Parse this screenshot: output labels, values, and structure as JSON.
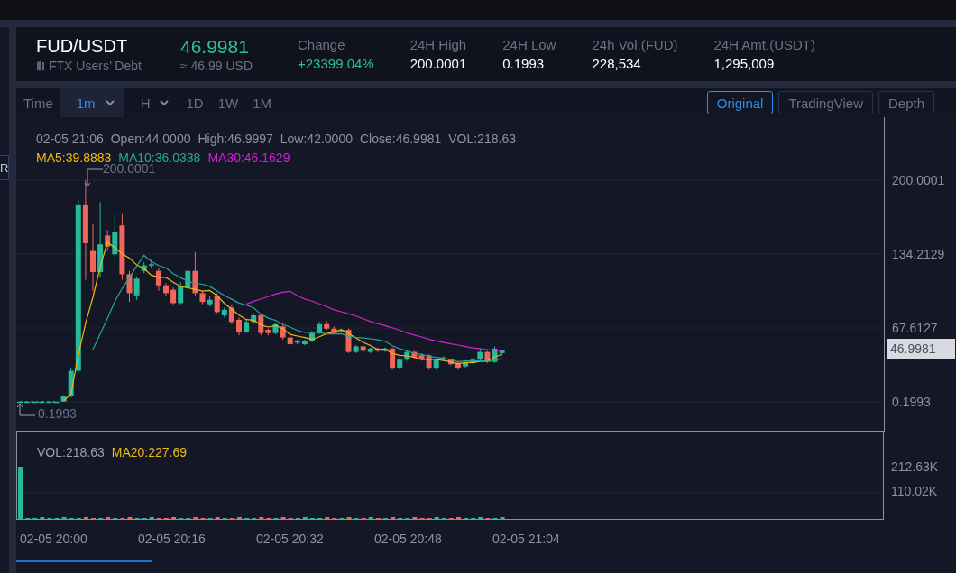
{
  "sidebar": {
    "button": "R"
  },
  "header": {
    "pair": "FUD/USDT",
    "name": "FTX Users’ Debt",
    "price": "46.9981",
    "price_usd": "≈ 46.99 USD",
    "stats": [
      {
        "label": "Change",
        "value": "+23399.04%",
        "kind": "change"
      },
      {
        "label": "24H High",
        "value": "200.0001",
        "kind": "plain"
      },
      {
        "label": "24H Low",
        "value": "0.1993",
        "kind": "plain"
      },
      {
        "label": "24h Vol.(FUD)",
        "value": "228,534",
        "kind": "plain"
      },
      {
        "label": "24H Amt.(USDT)",
        "value": "1,295,009",
        "kind": "plain"
      }
    ]
  },
  "toolbar": {
    "label": "Time",
    "intervals": [
      {
        "label": "1m",
        "selected": true,
        "dropdown": true
      },
      {
        "label": "H",
        "selected": false,
        "dropdown": true
      },
      {
        "label": "1D",
        "selected": false,
        "dropdown": false
      },
      {
        "label": "1W",
        "selected": false,
        "dropdown": false
      },
      {
        "label": "1M",
        "selected": false,
        "dropdown": false
      }
    ],
    "views": [
      {
        "label": "Original",
        "selected": true
      },
      {
        "label": "TradingView",
        "selected": false
      },
      {
        "label": "Depth",
        "selected": false
      }
    ]
  },
  "price_chart": {
    "info": [
      "02-05 21:06",
      "Open:44.0000",
      "High:46.9997",
      "Low:42.0000",
      "Close:46.9981",
      "VOL:218.63"
    ],
    "moving_averages": [
      {
        "label": "MA5:39.8883",
        "color": "#f0b90b"
      },
      {
        "label": "MA10:36.0338",
        "color": "#26a69a"
      },
      {
        "label": "MA30:46.1629",
        "color": "#d41fd4"
      }
    ],
    "high_marker": "200.0001",
    "low_marker": "0.1993",
    "axis_labels": [
      "200.0001",
      "134.2129",
      "67.6127",
      "0.1993"
    ],
    "last_price": "46.9981"
  },
  "volume_chart": {
    "legend": [
      {
        "label": "VOL:218.63",
        "color": "#9aa0b0"
      },
      {
        "label": "MA20:227.69",
        "color": "#f0b90b"
      }
    ],
    "axis_labels": [
      "212.63K",
      "110.02K"
    ]
  },
  "time_axis": [
    "02-05 20:00",
    "02-05 20:16",
    "02-05 20:32",
    "02-05 20:48",
    "02-05 21:04"
  ]
}
